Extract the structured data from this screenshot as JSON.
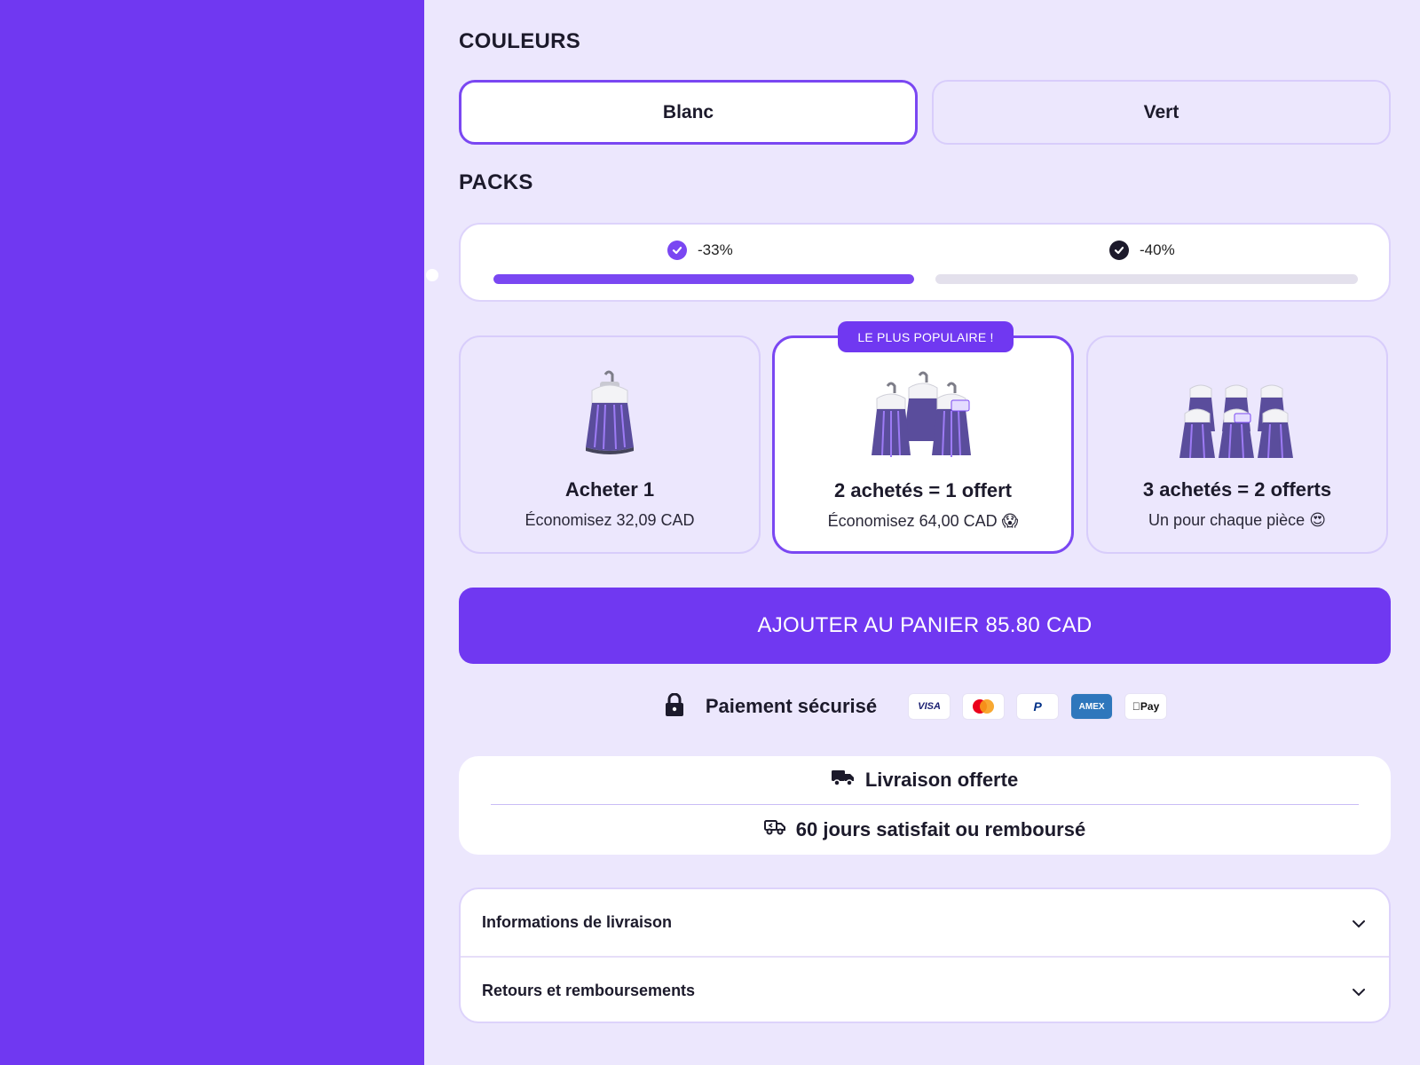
{
  "colors_section": {
    "title": "COULEURS",
    "options": [
      {
        "label": "Blanc",
        "selected": true
      },
      {
        "label": "Vert",
        "selected": false
      }
    ]
  },
  "packs_section": {
    "title": "PACKS",
    "discount_tiers": [
      {
        "label": "-33%",
        "reached": true,
        "check_color": "#7a47f2",
        "progress": 1.0
      },
      {
        "label": "-40%",
        "reached": false,
        "check_color": "#1c1a2b",
        "progress": 0.0
      }
    ],
    "popular_badge": "LE PLUS POPULAIRE !",
    "packs": [
      {
        "title": "Acheter 1",
        "subtitle": "Économisez 32,09 CAD",
        "emoji": "",
        "image": "single-lamp-icon",
        "selected": false
      },
      {
        "title": "2 achetés = 1 offert",
        "subtitle": "Économisez 64,00 CAD",
        "emoji": "😱",
        "image": "three-lamps-icon",
        "selected": true
      },
      {
        "title": "3 achetés = 2 offerts",
        "subtitle": "Un pour chaque pièce",
        "emoji": "😍",
        "image": "five-lamps-icon",
        "selected": false
      }
    ]
  },
  "cta": {
    "label": "AJOUTER AU PANIER 85.80 CAD"
  },
  "secure_payment": {
    "label": "Paiement sécurisé",
    "icon": "lock-icon",
    "methods": [
      {
        "name": "visa",
        "label": "VISA"
      },
      {
        "name": "mastercard",
        "label": ""
      },
      {
        "name": "paypal",
        "label": "P"
      },
      {
        "name": "amex",
        "label": "AMEX"
      },
      {
        "name": "applepay",
        "label": "Pay"
      }
    ]
  },
  "guarantees": [
    {
      "label": "Livraison offerte",
      "icon": "truck-icon"
    },
    {
      "label": "60 jours satisfait ou remboursé",
      "icon": "return-truck-icon"
    }
  ],
  "accordion": [
    {
      "label": "Informations de livraison"
    },
    {
      "label": "Retours et remboursements"
    }
  ],
  "theme": {
    "accent": "#7038f1",
    "accent_light": "#ece7fd",
    "border": "#d8cdfb"
  }
}
